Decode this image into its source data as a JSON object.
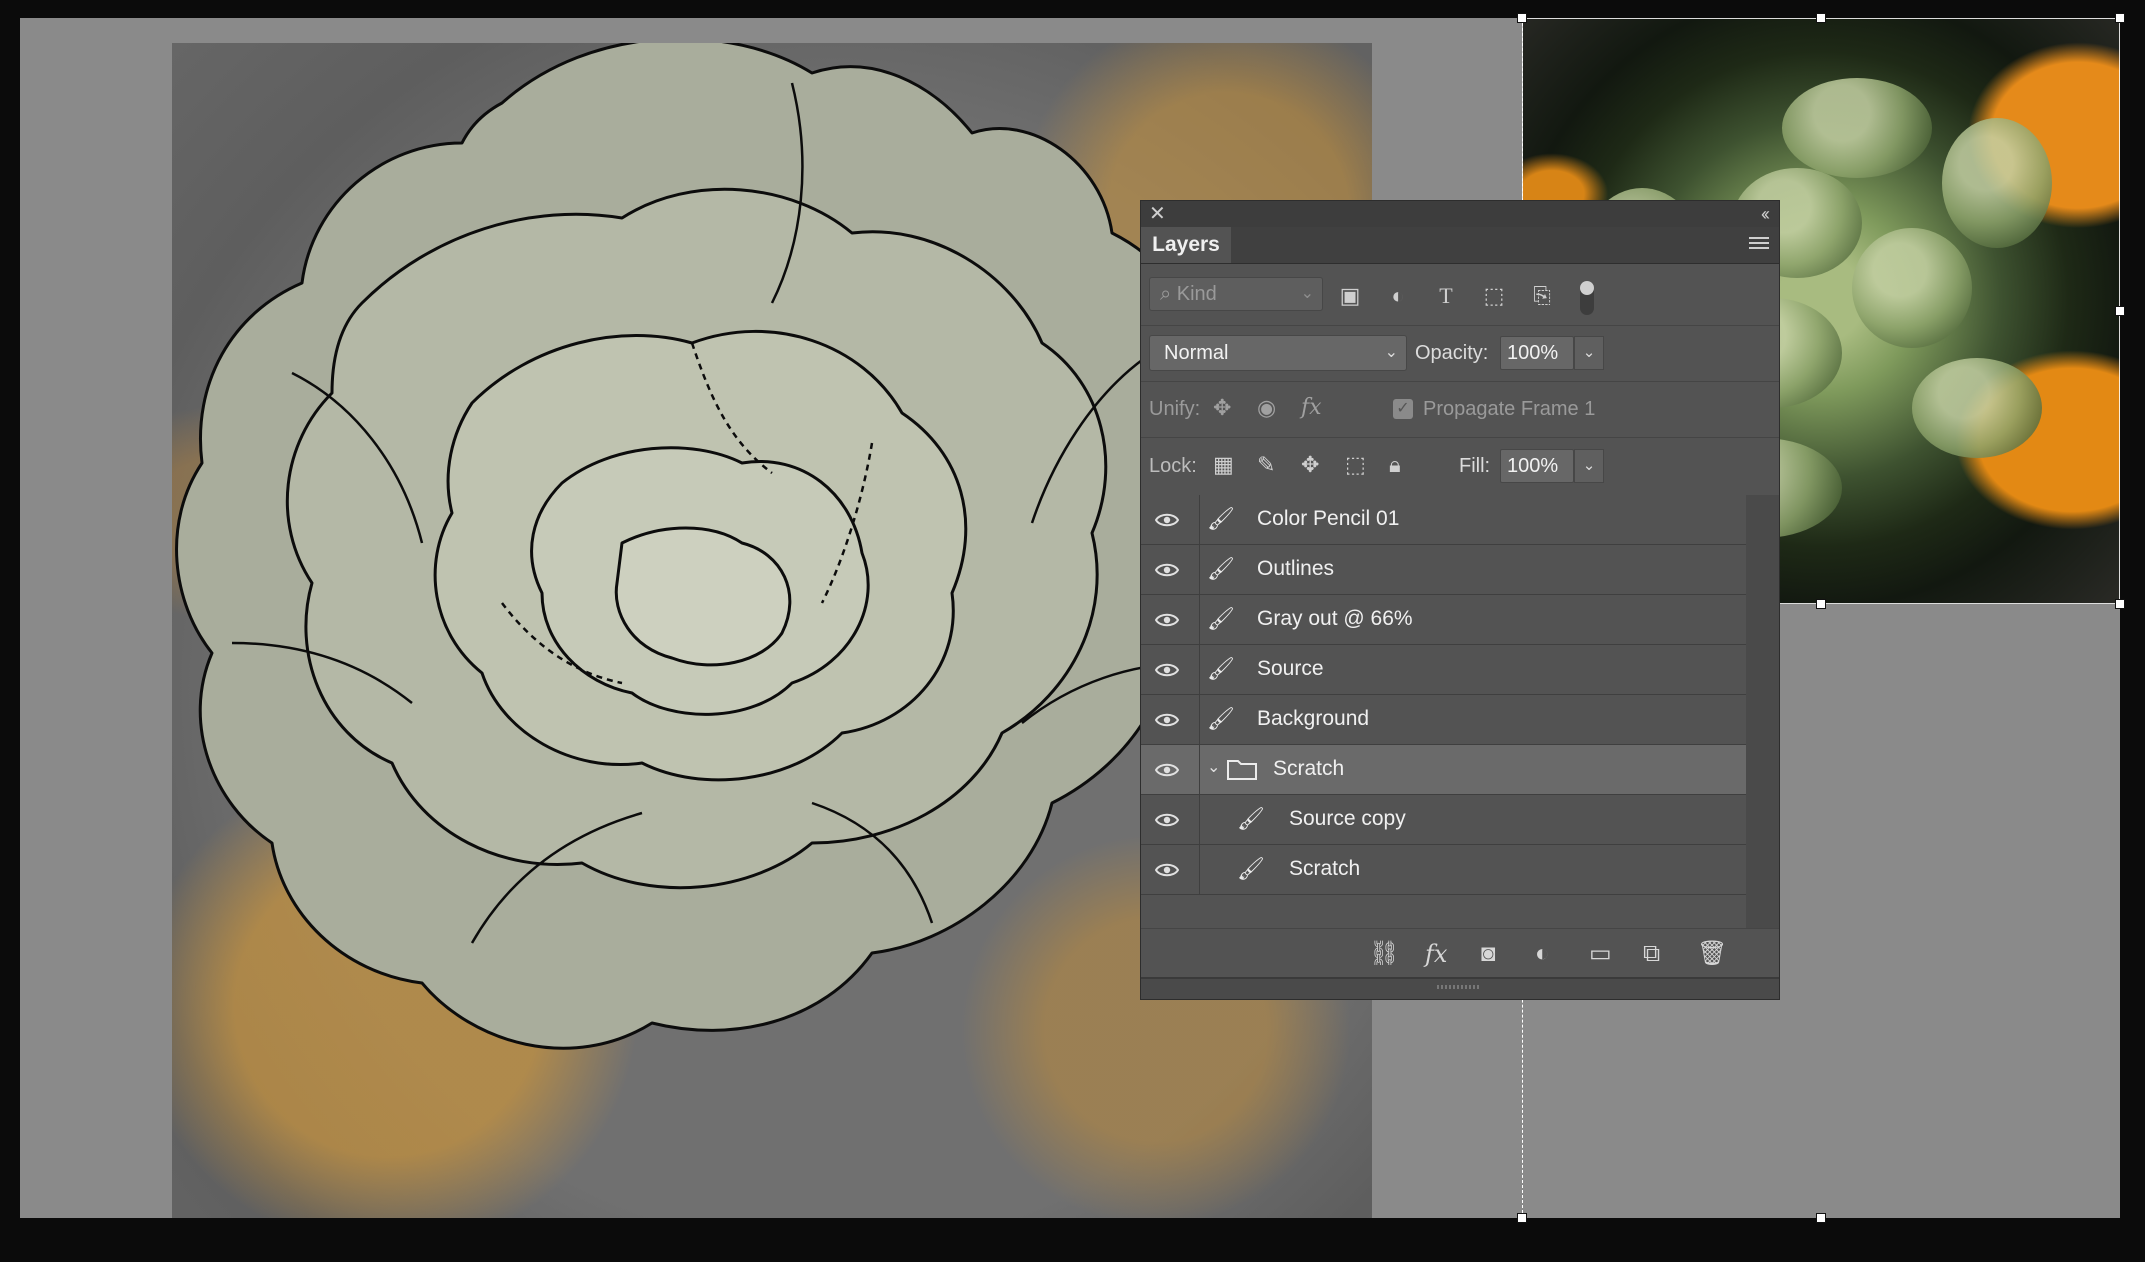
{
  "panel": {
    "title": "Layers",
    "close_glyph": "✕",
    "collapse_glyph": "‹‹",
    "filter": {
      "placeholder": "Kind"
    },
    "blend_mode": "Normal",
    "opacity_label": "Opacity:",
    "opacity_value": "100%",
    "unify_label": "Unify:",
    "propagate_label": "Propagate Frame 1",
    "lock_label": "Lock:",
    "fill_label": "Fill:",
    "fill_value": "100%"
  },
  "layers": [
    {
      "name": "Color Pencil 01",
      "visible": true,
      "type": "pixel"
    },
    {
      "name": "Outlines",
      "visible": true,
      "type": "pixel"
    },
    {
      "name": "Gray out @ 66%",
      "visible": true,
      "type": "pixel"
    },
    {
      "name": "Source",
      "visible": true,
      "type": "pixel"
    },
    {
      "name": "Background",
      "visible": true,
      "type": "pixel"
    },
    {
      "name": "Scratch",
      "visible": true,
      "type": "group",
      "expanded": true,
      "selected": true
    },
    {
      "name": "Source copy",
      "visible": true,
      "type": "pixel",
      "indent": true
    },
    {
      "name": "Scratch",
      "visible": true,
      "type": "pixel",
      "indent": true
    }
  ],
  "footer_icons": [
    "link-layers-icon",
    "fx-icon",
    "mask-icon",
    "adjustment-icon",
    "new-group-icon",
    "new-layer-icon",
    "trash-icon"
  ],
  "colors": {
    "panel_bg": "#535353",
    "canvas_bg": "#8a8a8a",
    "selected_row": "#6a6a6a"
  }
}
